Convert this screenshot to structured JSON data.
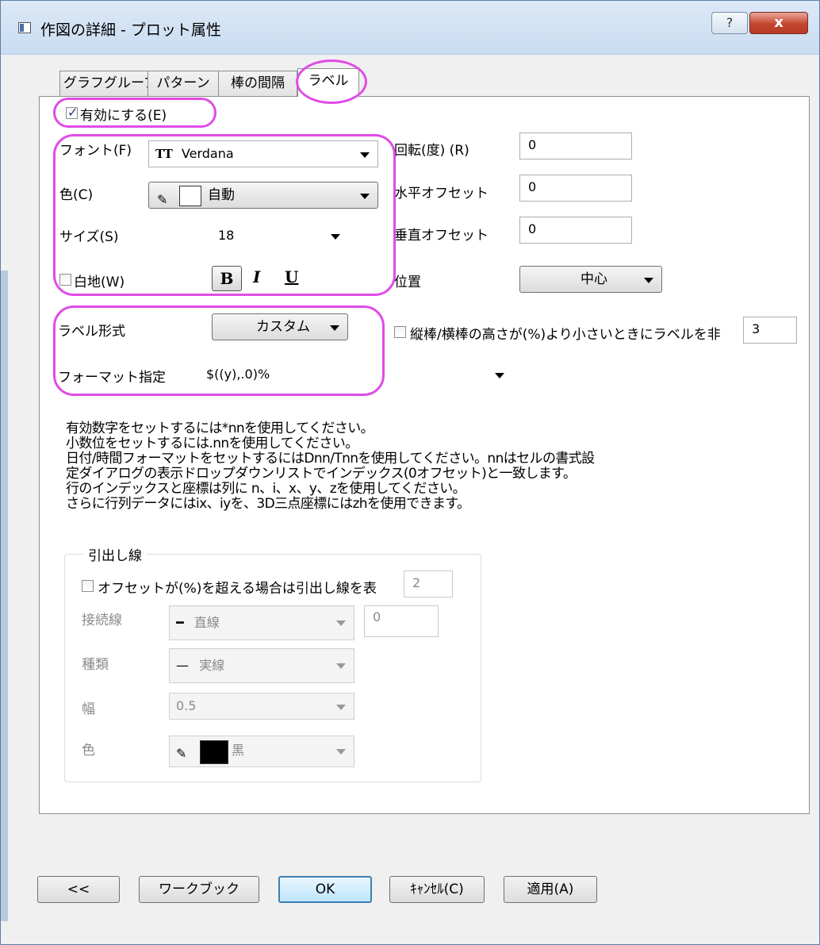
{
  "window": {
    "title": "作図の詳細 - プロット属性",
    "help_button": "?",
    "close_button": "x"
  },
  "tabs": [
    "グラフグループ",
    "パターン",
    "棒の間隔",
    "ラベル"
  ],
  "enable": {
    "label": "有効にする(E)",
    "checked": true
  },
  "font": {
    "label": "フォント(F)",
    "value": "Verdana",
    "icon": "TT"
  },
  "color": {
    "label": "色(C)",
    "value": "自動",
    "swatch": "#ffffff"
  },
  "size": {
    "label": "サイズ(S)",
    "value": "18"
  },
  "white_bg": {
    "label": "白地(W)",
    "checked": false
  },
  "style_buttons": {
    "bold": "B",
    "italic": "I",
    "underline": "U"
  },
  "rotation": {
    "label": "回転(度) (R)",
    "value": "0"
  },
  "h_offset": {
    "label": "水平オフセット",
    "value": "0"
  },
  "v_offset": {
    "label": "垂直オフセット",
    "value": "0"
  },
  "position": {
    "label": "位置",
    "value": "中心"
  },
  "label_form": {
    "label": "ラベル形式",
    "value": "カスタム"
  },
  "hide_small": {
    "label": "縦棒/横棒の高さが(%)より小さいときにラベルを非",
    "value": "3",
    "checked": false
  },
  "format": {
    "label": "フォーマット指定",
    "value": "$((y),.0)%"
  },
  "help_lines": [
    "有効数字をセットするには*nnを使用してください。",
    "小数位をセットするには.nnを使用してください。",
    "日付/時間フォーマットをセットするにはDnn/Tnnを使用してください。nnはセルの書式設",
    "定ダイアログの表示ドロップダウンリストでインデックス(0オフセット)と一致します。",
    "行のインデックスと座標は列に n、i、x、y、zを使用してください。",
    "さらに行列データにはix、iyを、3D三点座標にはzhを使用できます。"
  ],
  "leader": {
    "title": "引出し線",
    "offset_label": "オフセットが(%)を超える場合は引出し線を表",
    "offset_value": "2",
    "connect_label": "接続線",
    "connect_value": "直線",
    "connect_extra": "0",
    "type_label": "種類",
    "type_value": "実線",
    "width_label": "幅",
    "width_value": "0.5",
    "color_label": "色",
    "color_value": "黒",
    "color_swatch": "#000000"
  },
  "buttons": {
    "back": "<<",
    "workbook": "ワークブック",
    "ok": "OK",
    "cancel": "ｷｬﾝｾﾙ(C)",
    "apply": "適用(A)"
  },
  "highlight_color": "#e04be6"
}
